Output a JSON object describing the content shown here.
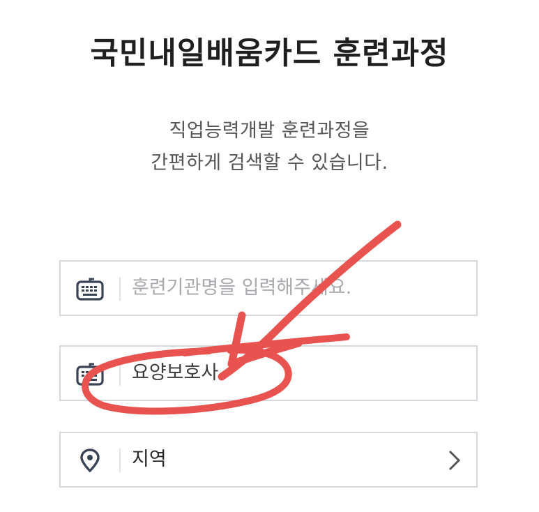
{
  "header": {
    "title": "국민내일배움카드 훈련과정",
    "subtitle_line1": "직업능력개발 훈련과정을",
    "subtitle_line2": "간편하게 검색할 수 있습니다."
  },
  "form": {
    "institution_field": {
      "placeholder": "훈련기관명을 입력해주세요.",
      "icon": "keyboard-icon"
    },
    "course_field": {
      "value": "요양보호사",
      "icon": "keyboard-icon"
    },
    "region_field": {
      "label": "지역",
      "icon": "location-pin-icon",
      "trailing_icon": "chevron-right-icon"
    }
  },
  "annotation": {
    "description": "hand-drawn red arrow and circle",
    "color": "#e8534f"
  },
  "colors": {
    "icon": "#3a4356",
    "border": "#d6d8dd",
    "placeholder": "#a7a9ad",
    "annotation": "#e8534f"
  }
}
